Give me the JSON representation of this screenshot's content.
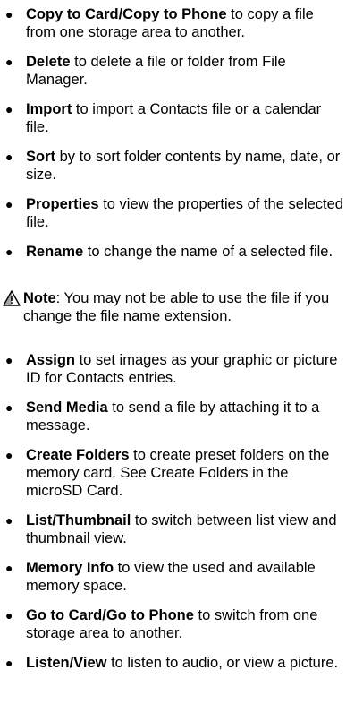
{
  "bullet_glyph": "●",
  "items": [
    {
      "term": "Copy to Card/Copy to Phone",
      "desc": " to copy a file from one storage area to another."
    },
    {
      "term": "Delete",
      "desc": " to delete a file or folder from File Manager."
    },
    {
      "term": "Import",
      "desc": " to import a Contacts file or a calendar file."
    },
    {
      "term": "Sort",
      "desc": " by to sort folder contents by name, date, or size."
    },
    {
      "term": "Properties",
      "desc": " to view the properties of the selected file."
    },
    {
      "term": "Rename",
      "desc": " to change the name of a selected file."
    }
  ],
  "note": {
    "icon": "warning-triangle-icon",
    "term": "Note",
    "desc": ": You may not be able to use the file if you change the file name extension."
  },
  "items2": [
    {
      "term": "Assign",
      "desc": " to set images as your graphic or picture ID for Contacts entries."
    },
    {
      "term": "Send Media",
      "desc": " to send a file by attaching it to a message."
    },
    {
      "term": "Create Folders",
      "desc": " to create preset folders on the memory card. See Create Folders in the microSD Card."
    },
    {
      "term": "List/Thumbnail",
      "desc": " to switch between list view and thumbnail view."
    },
    {
      "term": "Memory Info",
      "desc": " to view the used and available memory space."
    },
    {
      "term": "Go to Card/Go to Phone",
      "desc": " to switch from one storage area to another."
    },
    {
      "term": "Listen/View",
      "desc": " to listen to audio, or view a picture."
    }
  ]
}
